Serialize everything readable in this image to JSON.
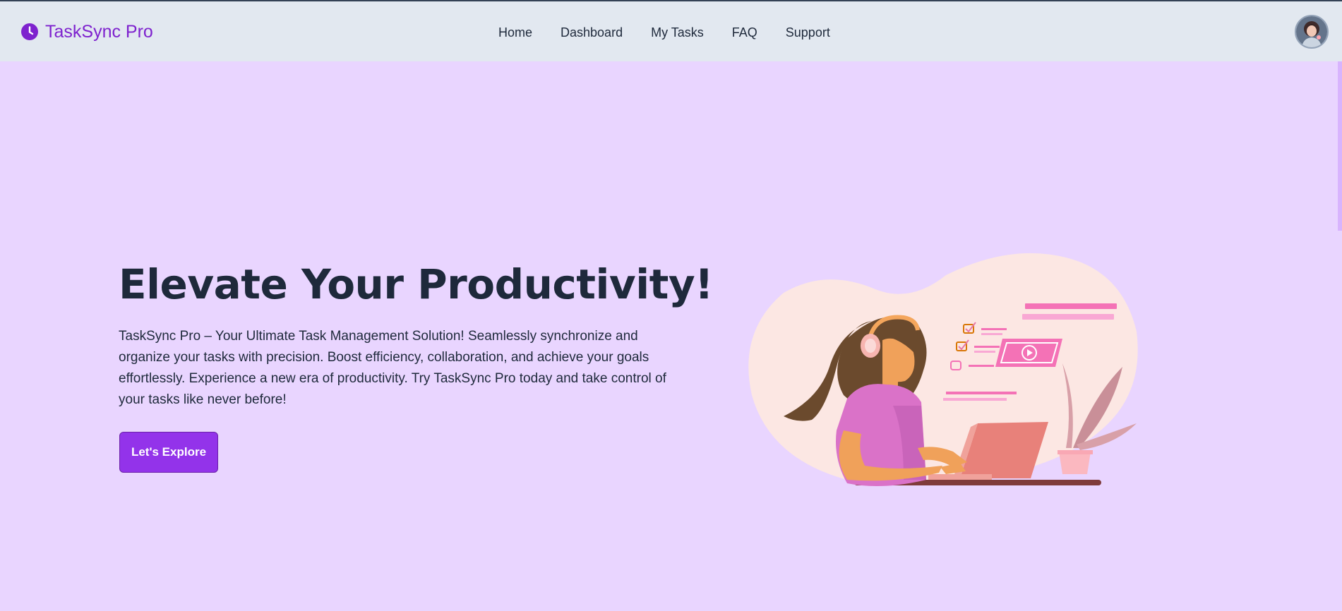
{
  "brand": {
    "name": "TaskSync Pro",
    "icon": "clock-icon",
    "color": "#7e22ce"
  },
  "nav": {
    "items": [
      {
        "label": "Home"
      },
      {
        "label": "Dashboard"
      },
      {
        "label": "My Tasks"
      },
      {
        "label": "FAQ"
      },
      {
        "label": "Support"
      }
    ]
  },
  "user": {
    "avatar_icon": "user-avatar"
  },
  "hero": {
    "title": "Elevate Your Productivity!",
    "description": "TaskSync Pro – Your Ultimate Task Management Solution! Seamlessly synchronize and organize your tasks with precision. Boost efficiency, collaboration, and achieve your goals effortlessly. Experience a new era of productivity. Try TaskSync Pro today and take control of your tasks like never before!",
    "cta_label": "Let's Explore",
    "illustration": "woman-working-on-laptop-illustration"
  },
  "colors": {
    "page_background": "#e9d5ff",
    "navbar_background": "#e2e8f0",
    "accent": "#9333ea",
    "text": "#1e293b"
  }
}
